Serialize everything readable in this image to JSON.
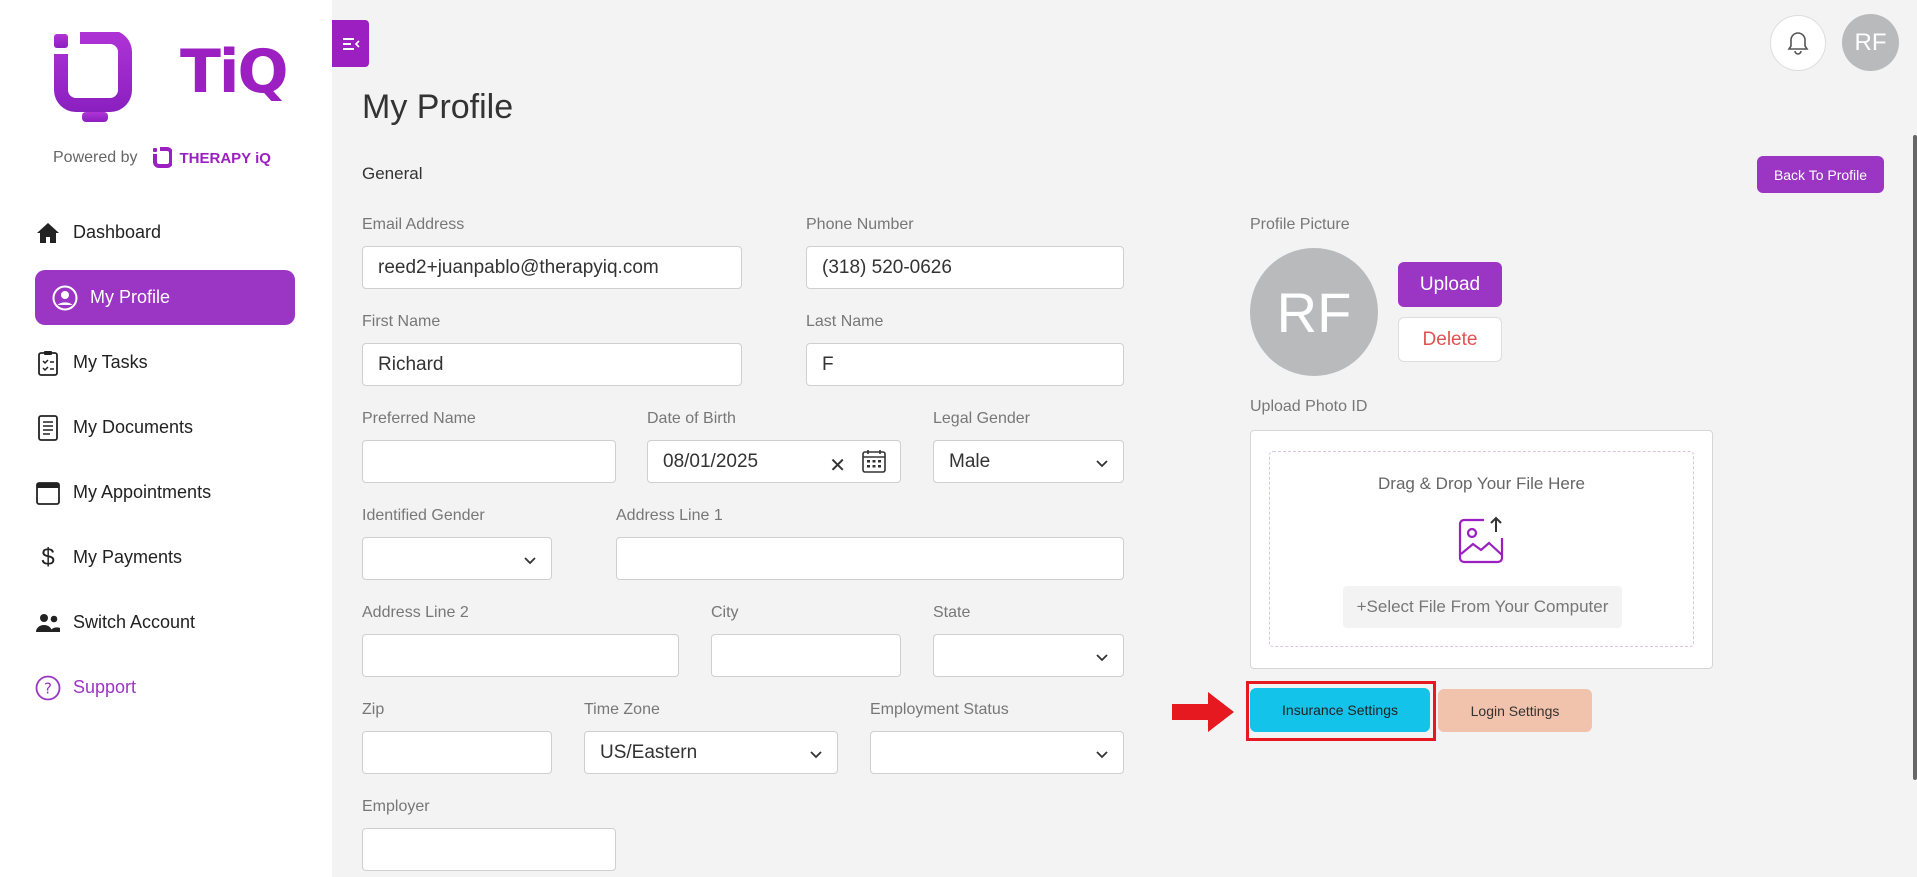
{
  "brand": {
    "app_name": "TiQ",
    "powered_by": "Powered by",
    "parent_brand": "THERAPY iQ",
    "accent_color": "#9b1fc1"
  },
  "sidebar": {
    "items": [
      {
        "label": "Dashboard",
        "icon": "home-icon"
      },
      {
        "label": "My Profile",
        "icon": "user-circle-icon"
      },
      {
        "label": "My Tasks",
        "icon": "task-list-icon"
      },
      {
        "label": "My Documents",
        "icon": "document-icon"
      },
      {
        "label": "My Appointments",
        "icon": "calendar-icon"
      },
      {
        "label": "My Payments",
        "icon": "dollar-icon"
      },
      {
        "label": "Switch Account",
        "icon": "users-icon"
      },
      {
        "label": "Support",
        "icon": "help-circle-icon"
      }
    ]
  },
  "header": {
    "avatar_initials": "RF"
  },
  "page": {
    "title": "My Profile",
    "section": "General",
    "back_button": "Back To Profile"
  },
  "form": {
    "email": {
      "label": "Email Address",
      "value": "reed2+juanpablo@therapyiq.com"
    },
    "phone": {
      "label": "Phone Number",
      "value": "(318) 520-0626"
    },
    "first_name": {
      "label": "First Name",
      "value": "Richard"
    },
    "last_name": {
      "label": "Last Name",
      "value": "F"
    },
    "preferred_name": {
      "label": "Preferred Name",
      "value": ""
    },
    "dob": {
      "label": "Date of Birth",
      "value": "08/01/2025"
    },
    "legal_gender": {
      "label": "Legal Gender",
      "value": "Male"
    },
    "identified_gender": {
      "label": "Identified Gender",
      "value": ""
    },
    "address1": {
      "label": "Address Line 1",
      "value": ""
    },
    "address2": {
      "label": "Address Line 2",
      "value": ""
    },
    "city": {
      "label": "City",
      "value": ""
    },
    "state": {
      "label": "State",
      "value": ""
    },
    "zip": {
      "label": "Zip",
      "value": ""
    },
    "time_zone": {
      "label": "Time Zone",
      "value": "US/Eastern"
    },
    "employment_status": {
      "label": "Employment Status",
      "value": ""
    },
    "employer": {
      "label": "Employer",
      "value": ""
    }
  },
  "profile_picture": {
    "label": "Profile Picture",
    "initials": "RF",
    "upload": "Upload",
    "delete": "Delete"
  },
  "photo_id": {
    "label": "Upload Photo ID",
    "drop_text": "Drag & Drop Your File Here",
    "select_text": "+Select File From Your Computer"
  },
  "settings": {
    "insurance": "Insurance Settings",
    "login": "Login Settings"
  }
}
